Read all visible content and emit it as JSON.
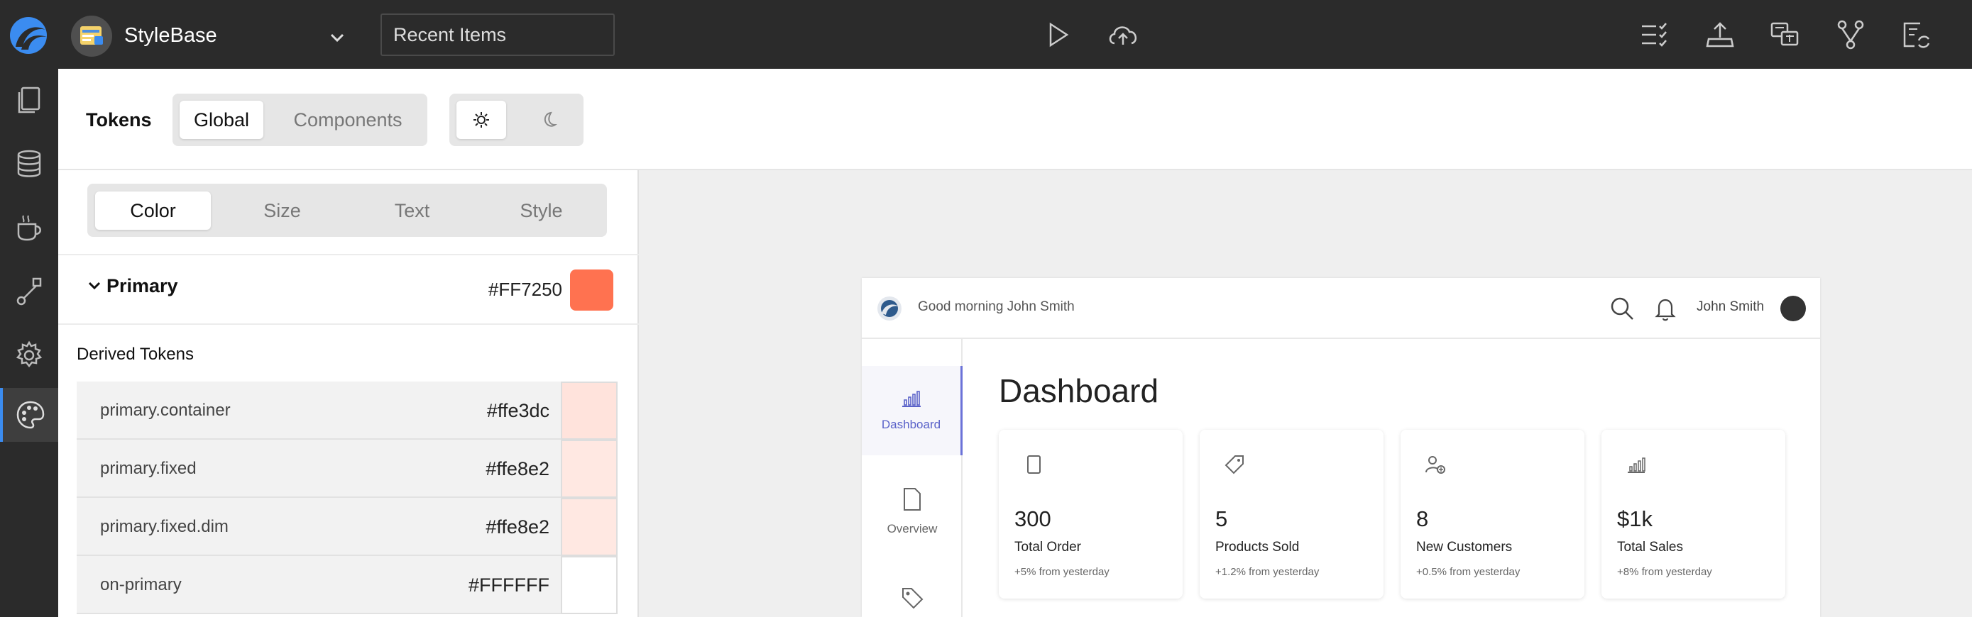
{
  "topbar": {
    "project_name": "StyleBase",
    "recent_items_label": "Recent Items"
  },
  "tokens_header": {
    "title": "Tokens",
    "scope_tabs": [
      "Global",
      "Components"
    ],
    "active_scope": "Global",
    "theme_modes": [
      "sun-icon",
      "moon-icon"
    ],
    "active_theme": "light"
  },
  "category_tabs": [
    "Color",
    "Size",
    "Text",
    "Style"
  ],
  "active_category": "Color",
  "primary": {
    "label": "Primary",
    "hex": "#FF7250",
    "color": "#FF7250"
  },
  "derived": {
    "label": "Derived Tokens",
    "tokens": [
      {
        "name": "primary.container",
        "hex": "#ffe3dc",
        "color": "#ffe3dc"
      },
      {
        "name": "primary.fixed",
        "hex": "#ffe8e2",
        "color": "#ffe8e2"
      },
      {
        "name": "primary.fixed.dim",
        "hex": "#ffe8e2",
        "color": "#ffe8e2"
      },
      {
        "name": "on-primary",
        "hex": "#FFFFFF",
        "color": "#FFFFFF"
      }
    ]
  },
  "preview": {
    "greeting": "Good morning John Smith",
    "user_name": "John Smith",
    "nav": [
      "Dashboard",
      "Overview"
    ],
    "title": "Dashboard",
    "cards": [
      {
        "value": "300",
        "label": "Total Order",
        "delta": "+5% from yesterday",
        "icon": "document-icon"
      },
      {
        "value": "5",
        "label": "Products Sold",
        "delta": "+1.2% from yesterday",
        "icon": "tag-icon"
      },
      {
        "value": "8",
        "label": "New Customers",
        "delta": "+0.5% from yesterday",
        "icon": "add-user-icon"
      },
      {
        "value": "$1k",
        "label": "Total Sales",
        "delta": "+8% from yesterday",
        "icon": "chart-icon"
      }
    ]
  },
  "colors": {
    "accent": "#3b8cf0",
    "nav_active": "#5a62c9"
  }
}
